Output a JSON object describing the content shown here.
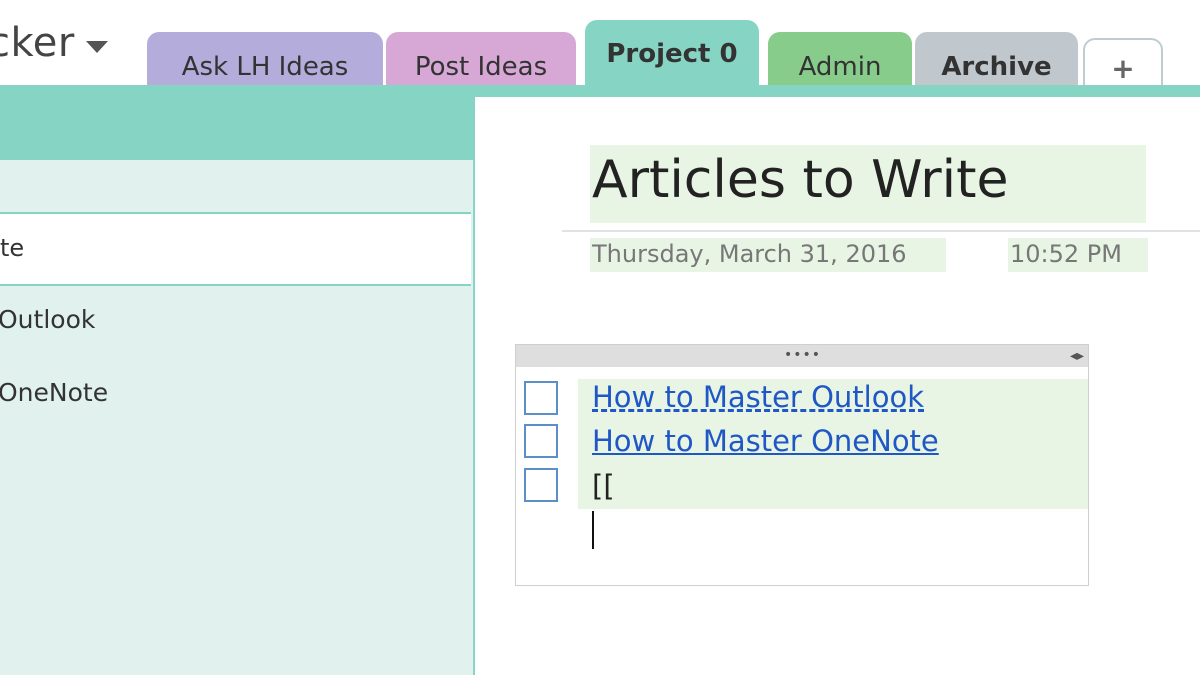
{
  "notebook": {
    "title": "cker"
  },
  "tabs": [
    {
      "label": "Ask LH Ideas",
      "color": "#b4acdb"
    },
    {
      "label": "Post Ideas",
      "color": "#d7a8d6"
    },
    {
      "label": "Project 0",
      "color": "#86d4c3",
      "active": true
    },
    {
      "label": "Admin",
      "color": "#88cc8b"
    },
    {
      "label": "Archive",
      "color": "#c0c7cd"
    },
    {
      "label": "+"
    }
  ],
  "page_list": {
    "selected_partial": "te",
    "items": [
      "Outlook",
      "OneNote"
    ]
  },
  "page": {
    "title": "Articles to Write",
    "date": "Thursday, March 31, 2016",
    "time": "10:52 PM"
  },
  "note": {
    "grip": "••••",
    "arrows": "◂▸",
    "todos": [
      {
        "text": "How to Master Outlook",
        "link": true
      },
      {
        "text": "How to Master OneNote",
        "link": true
      },
      {
        "text": "[[",
        "link": false
      }
    ]
  },
  "colors": {
    "accent": "#86d4c3",
    "highlight": "#e8f5e4",
    "link": "#1f57c7"
  }
}
